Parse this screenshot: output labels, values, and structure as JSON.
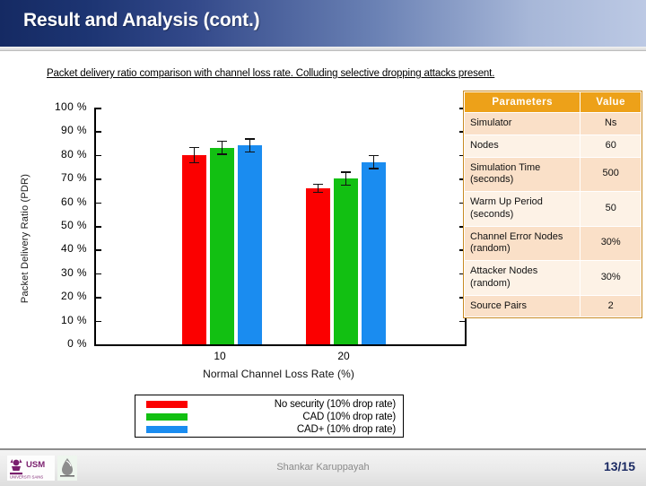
{
  "slide": {
    "title": "Result and Analysis (cont.)",
    "caption": "Packet delivery ratio comparison with channel loss rate. Colluding selective dropping attacks present."
  },
  "colors": {
    "title_gradient_start": "#152a63",
    "title_gradient_end": "#bcc9e4",
    "series_red": "#fb0000",
    "series_green": "#12c012",
    "series_blue": "#1a8cf0",
    "table_header": "#eda119",
    "table_row_odd": "#fae0c8",
    "table_row_even": "#fdf2e6",
    "page_number": "#1b2a63"
  },
  "chart_data": {
    "type": "bar",
    "title": "",
    "xlabel": "Normal Channel Loss Rate (%)",
    "ylabel": "Packet Delivery Ratio (PDR)",
    "categories": [
      "10",
      "20"
    ],
    "ylim": [
      0,
      100
    ],
    "yticks": [
      "0 %",
      "10 %",
      "20 %",
      "30 %",
      "40 %",
      "50 %",
      "60 %",
      "70 %",
      "80 %",
      "90 %",
      "100 %"
    ],
    "ytick_values": [
      0,
      10,
      20,
      30,
      40,
      50,
      60,
      70,
      80,
      90,
      100
    ],
    "grid": false,
    "legend_position": "bottom",
    "error_bars": true,
    "series": [
      {
        "name": "No security (10% drop rate)",
        "color": "#fb0000",
        "values": [
          80,
          66
        ],
        "errors": [
          3.5,
          2.0
        ]
      },
      {
        "name": "CAD (10% drop rate)",
        "color": "#12c012",
        "values": [
          83,
          70
        ],
        "errors": [
          3.0,
          3.0
        ]
      },
      {
        "name": "CAD+ (10% drop rate)",
        "color": "#1a8cf0",
        "values": [
          84,
          77
        ],
        "errors": [
          3.0,
          3.0
        ]
      }
    ]
  },
  "parameters_table": {
    "headers": [
      "Parameters",
      "Value"
    ],
    "rows": [
      {
        "name": "Simulator",
        "value": "Ns"
      },
      {
        "name": "Nodes",
        "value": "60"
      },
      {
        "name": "Simulation Time (seconds)",
        "value": "500"
      },
      {
        "name": "Warm Up Period (seconds)",
        "value": "50"
      },
      {
        "name": "Channel Error Nodes (random)",
        "value": "30%"
      },
      {
        "name": "Attacker Nodes (random)",
        "value": "30%"
      },
      {
        "name": "Source Pairs",
        "value": "2"
      }
    ]
  },
  "footer": {
    "author": "Shankar Karuppayah",
    "page": "13/15",
    "logos": [
      "usm-logo",
      "unit-logo"
    ]
  }
}
